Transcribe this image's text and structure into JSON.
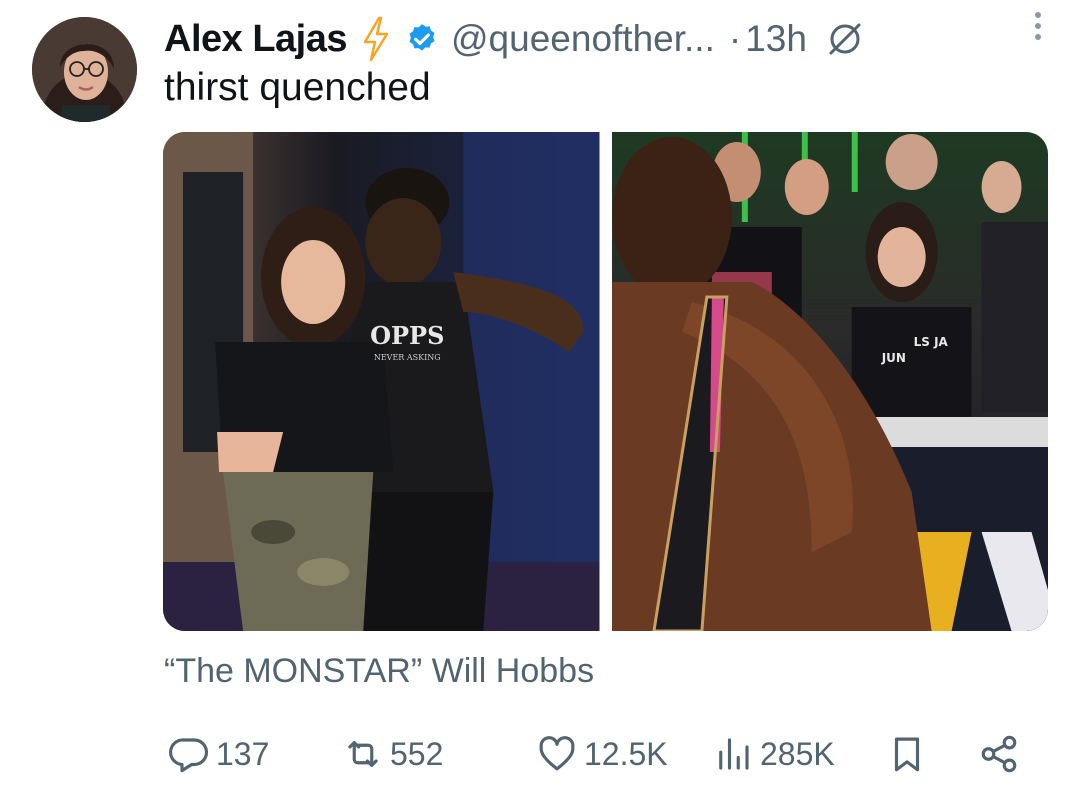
{
  "post": {
    "author_name": "Alex Lajas",
    "handle": "@queenofther...",
    "separator": "·",
    "time": "13h",
    "text": "thirst quenched",
    "quoted_text": "“The MONSTAR” Will Hobbs",
    "shirt_text_1": "OPPS",
    "shirt_text_2": "NEVER ASKING",
    "shirt_text_3": "JUN",
    "shirt_text_4": "LS JA"
  },
  "icons": {
    "bolt": "lightning-bolt-icon",
    "verified": "verified-badge-icon",
    "grok": "grok-icon",
    "more": "more-vertical-icon"
  },
  "actions": {
    "reply_count": "137",
    "repost_count": "552",
    "like_count": "12.5K",
    "view_count": "285K"
  },
  "colors": {
    "accent_blue": "#1d9bf0",
    "bolt_orange": "#f5a623",
    "text_secondary": "#536471"
  }
}
